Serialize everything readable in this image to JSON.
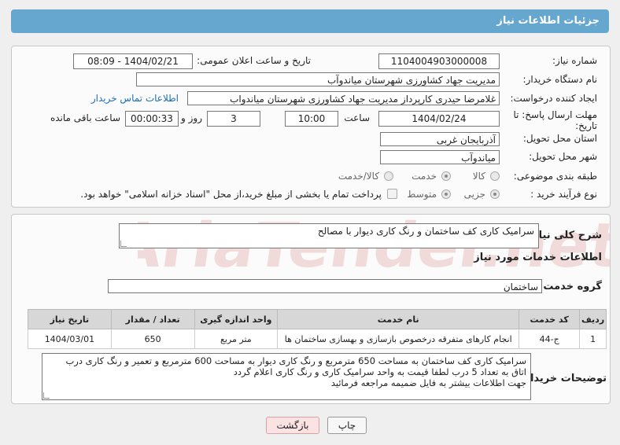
{
  "header": {
    "title": "جزئیات اطلاعات نیاز"
  },
  "form": {
    "need_number": {
      "label": "شماره نیاز:",
      "value": "1104004903000008"
    },
    "announce": {
      "label": "تاریخ و ساعت اعلان عمومی:",
      "value": "1404/02/21 - 08:09"
    },
    "buyer_org": {
      "label": "نام دستگاه خریدار:",
      "value": "مدیریت جهاد کشاورزی شهرستان میاندوآب"
    },
    "requester": {
      "label": "ایجاد کننده درخواست:",
      "value": "غلامرضا حیدری کارپرداز مدیریت جهاد کشاورزی شهرستان میاندواب",
      "contact_link": "اطلاعات تماس خریدار"
    },
    "deadline": {
      "label_line1": "مهلت ارسال پاسخ: تا",
      "label_line2": "تاریخ:",
      "date": "1404/02/24",
      "time_label": "ساعت",
      "time": "10:00",
      "days": "3",
      "days_label": "روز و",
      "remaining": "00:00:33",
      "remaining_label": "ساعت باقی مانده"
    },
    "province": {
      "label": "استان محل تحویل:",
      "value": "آذربایجان غربی"
    },
    "city": {
      "label": "شهر محل تحویل:",
      "value": "میاندوآب"
    },
    "category": {
      "label": "طبقه بندی موضوعی:",
      "options": [
        "کالا",
        "خدمت",
        "کالا/خدمت"
      ],
      "selected": "خدمت"
    },
    "process": {
      "label": "نوع فرآیند خرید :",
      "options": [
        "جزیی",
        "متوسط"
      ],
      "selected": "جزیی",
      "payment_note": "پرداخت تمام یا بخشی از مبلغ خرید،از محل \"اسناد خزانه اسلامی\" خواهد بود."
    }
  },
  "summary": {
    "label": "شرح کلی نیاز:",
    "value": "سرامیک کاری کف ساختمان و رنگ کاری دیوار با مصالح"
  },
  "services": {
    "section_title": "اطلاعات خدمات مورد نیاز",
    "group_label": "گروه خدمت:",
    "group_value": "ساختمان",
    "columns": [
      "ردیف",
      "کد خدمت",
      "نام خدمت",
      "واحد اندازه گیری",
      "تعداد / مقدار",
      "تاریخ نیاز"
    ],
    "rows": [
      {
        "index": "1",
        "code": "ج-44",
        "name": "انجام کارهای متفرقه درخصوص بازسازی و بهسازی ساختمان ها",
        "unit": "متر مربع",
        "qty": "650",
        "date": "1404/03/01"
      }
    ]
  },
  "buyer_notes": {
    "label": "توضیحات خریدار:",
    "lines": [
      "سرامیک کاری کف ساختمان به مساحت 650 مترمربع و رنگ کاری دیوار به مساحت 600 مترمربع و تعمیر و رنگ کاری درب",
      "اتاق به تعداد 5 درب      لطفا قیمت به واحد سرامیک کاری و رنگ کاری  اعلام گردد",
      "جهت اطلاعات بیشتر به فایل ضمیمه مراجعه فرمائید"
    ]
  },
  "buttons": {
    "print": "چاپ",
    "back": "بازگشت"
  },
  "watermark": {
    "text": "AriaTender.net"
  }
}
